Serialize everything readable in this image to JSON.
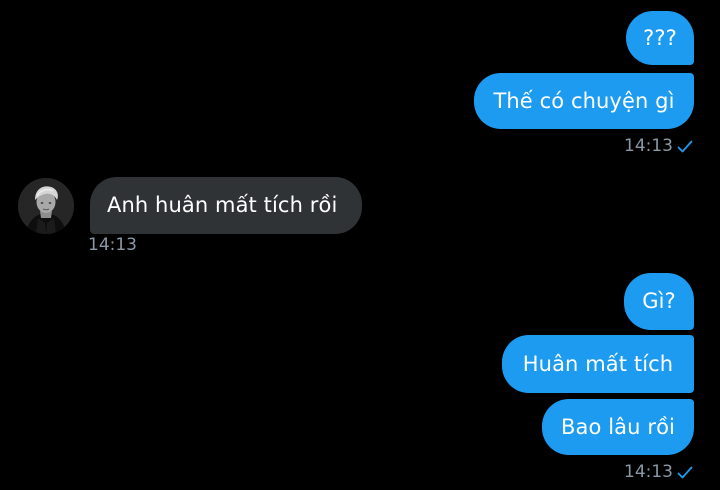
{
  "conversation": {
    "outgoing_group_1": {
      "messages": [
        "???",
        "Thế có chuyện gì"
      ],
      "timestamp": "14:13",
      "status_icon": "sent-check-icon"
    },
    "incoming_group": {
      "messages": [
        "Anh huân mất tích rồi"
      ],
      "timestamp": "14:13",
      "avatar_icon": "contact-avatar"
    },
    "outgoing_group_2": {
      "messages": [
        "Gì?",
        "Huân mất tích",
        "Bao lâu rồi"
      ],
      "timestamp": "14:13",
      "status_icon": "sent-check-icon"
    }
  },
  "colors": {
    "background": "#000000",
    "outgoing_bubble": "#1d9bf0",
    "incoming_bubble": "#2f3336",
    "timestamp_text": "#8b98a5",
    "check_mark": "#1d9bf0"
  }
}
